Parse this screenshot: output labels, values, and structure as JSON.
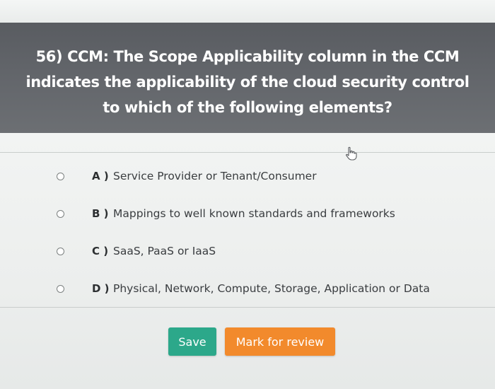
{
  "question": {
    "text": "56) CCM: The Scope Applicability column in the CCM indicates the applicability of the cloud security control to which of the following elements?"
  },
  "options": [
    {
      "letter": "A )",
      "text": "Service Provider or Tenant/Consumer"
    },
    {
      "letter": "B )",
      "text": "Mappings to well known standards and frameworks"
    },
    {
      "letter": "C )",
      "text": "SaaS, PaaS or IaaS"
    },
    {
      "letter": "D )",
      "text": "Physical, Network, Compute, Storage, Application or Data"
    }
  ],
  "actions": {
    "save_label": "Save",
    "review_label": "Mark for review"
  },
  "colors": {
    "header_bg": "#5f6267",
    "save_button": "#2ca88a",
    "review_button": "#f28a2c"
  },
  "icons": {
    "cursor": "hand-pointer-icon",
    "radio": "radio-unchecked-icon"
  }
}
